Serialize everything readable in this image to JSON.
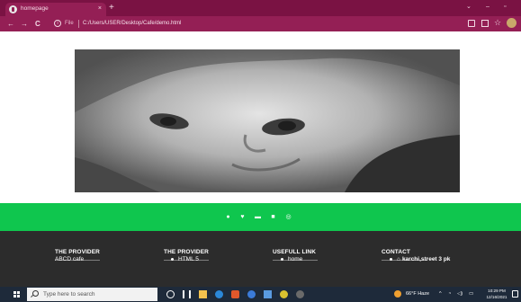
{
  "browser": {
    "tab_title": "homepage",
    "tab_close": "×",
    "new_tab": "+",
    "window_controls": {
      "minimize": "–",
      "restore": "▫",
      "dropdown": "⌄"
    },
    "nav": {
      "back": "←",
      "forward": "→",
      "reload": "C"
    },
    "address": {
      "scheme_label": "File",
      "url": "C:/Users/USER/Desktop/Cafe/demo.html"
    },
    "accent_color": "#7a1243"
  },
  "hero": {
    "image_alt": "baby photo"
  },
  "social": {
    "bar_color": "#0fc64e",
    "icons": [
      "facebook-icon",
      "twitter-icon",
      "mail-icon",
      "youtube-icon",
      "instagram-icon"
    ]
  },
  "footer": {
    "columns": [
      {
        "heading": "THE PROVIDER",
        "item": "ABCD cafe"
      },
      {
        "heading": "THE PROVIDER",
        "item": "HTML 5"
      },
      {
        "heading": "USEFULL LINK",
        "item": "home"
      },
      {
        "heading": "CONTACT",
        "item": "karchi,street 3 pk"
      }
    ]
  },
  "taskbar": {
    "search_placeholder": "Type here to search",
    "weather": "66°F Haze",
    "tray_arrow": "^",
    "time": "10:29 PM",
    "date": "12/16/2021"
  }
}
